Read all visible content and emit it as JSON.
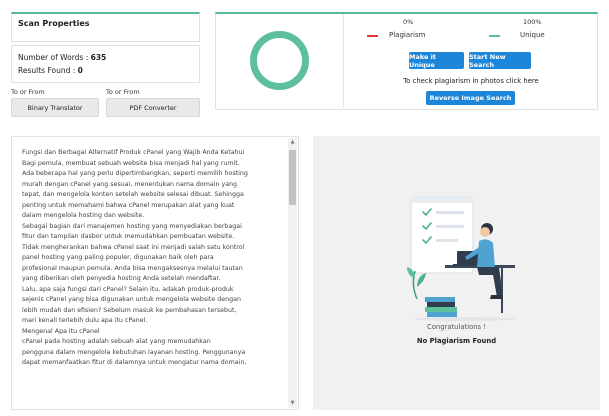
{
  "scan": {
    "title": "Scan Properties",
    "words_label": "Number of Words :",
    "words_value": "635",
    "results_label": "Results Found :",
    "results_value": "0"
  },
  "converters": [
    {
      "label": "To or From",
      "button": "Binary Translator"
    },
    {
      "label": "To or From",
      "button": "PDF Converter"
    }
  ],
  "result": {
    "plagiarism_pct": "0%",
    "unique_pct": "100%",
    "plagiarism_label": "Plagiarism",
    "unique_label": "Unique",
    "plagiarism_color": "#e53935",
    "unique_color": "#5dbf9b",
    "unique_fraction": 1.0,
    "make_unique_btn": "Make it Unique",
    "new_search_btn": "Start New Search",
    "photo_text": "To check plagiarism in photos click here",
    "reverse_btn": "Reverse Image Search"
  },
  "text_lines": [
    "Fungsi dan Berbagai Alternatif Produk cPanel yang Wajib Anda Ketahui",
    "Bagi pemula, membuat sebuah website bisa menjadi hal yang rumit.",
    "Ada beberapa hal yang perlu dipertimbangkan, seperti memilih hosting",
    "murah dengan cPanel yang sesuai, menentukan nama domain yang",
    "tepat, dan mengelola konten setelah website selesai dibuat. Sehingga",
    "penting untuk memahami bahwa cPanel merupakan alat yang kuat",
    "dalam mengelola hosting dan website.",
    "Sebagai bagian dari manajemen hosting yang menyediakan berbagai",
    "fitur dan tampilan dasbor untuk memudahkan pembuatan website.",
    "Tidak mengherankan bahwa cPanel saat ini menjadi salah satu kontrol",
    "panel hosting yang paling populer, digunakan baik oleh para",
    "profesional maupun pemula. Anda bisa mengaksesnya melalui tautan",
    "yang diberikan oleh penyedia hosting Anda setelah mendaftar.",
    "Lalu, apa saja fungsi dari cPanel? Selain itu, adakah produk-produk",
    "sejenis cPanel yang bisa digunakan untuk mengelola website dengan",
    "lebih mudah dan efisien? Sebelum masuk ke pembahasan tersebut,",
    "mari kenali terlebih dulu apa itu cPanel.",
    "Mengenal Apa itu cPanel",
    "cPanel pada hosting adalah sebuah alat yang memudahkan",
    "pengguna dalam mengelola kebutuhan layanan hosting. Penggunanya",
    "dapat memanfaatkan fitur di dalamnya untuk mengatur nama domain,"
  ],
  "status": {
    "congrats": "Congratulations !",
    "no_plag": "No Plagiarism Found"
  }
}
